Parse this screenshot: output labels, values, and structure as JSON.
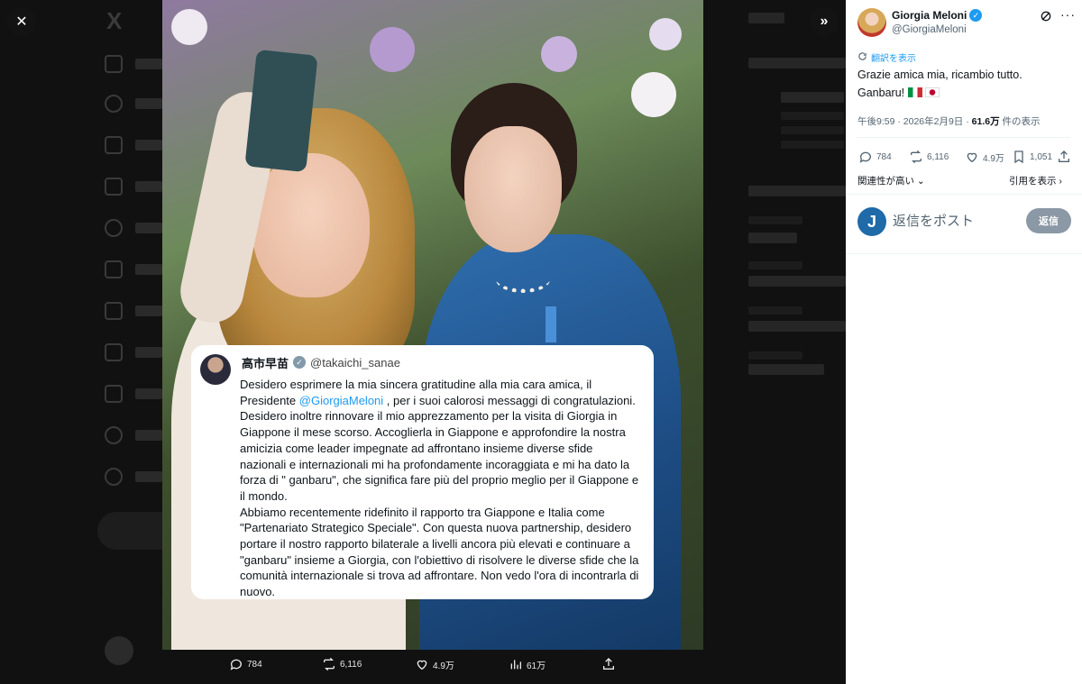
{
  "photo_post": {
    "quote": {
      "author_name": "高市早苗",
      "author_handle": "@takaichi_sanae",
      "text_before_mention": "Desidero esprimere la mia sincera gratitudine alla mia cara amica, il Presidente ",
      "mention": "@GiorgiaMeloni",
      "text_after_mention": " , per i suoi calorosi messaggi di congratulazioni. Desidero inoltre rinnovare il mio apprezzamento per la visita di Giorgia in Giappone il mese scorso. Accoglierla  in Giappone e approfondire la nostra amicizia come leader impegnate ad affrontano insieme diverse sfide nazionali e internazionali mi ha profondamente incoraggiata e mi ha dato la forza di \" ganbaru\", che significa fare più del proprio meglio per il Giappone e il mondo.\nAbbiamo recentemente ridefinito il rapporto tra Giappone e Italia come \"Partenariato Strategico Speciale\". Con questa nuova partnership, desidero portare il nostro rapporto bilaterale a livelli ancora più elevati e continuare a \"ganbaru\" insieme a Giorgia, con l'obiettivo di risolvere le diverse sfide che la comunità internazionale si trova ad affrontare. Non vedo l'ora di incontrarla di nuovo."
    },
    "media_actions": {
      "replies": "784",
      "reposts": "6,116",
      "likes": "4.9万",
      "views": "61万"
    }
  },
  "side_panel": {
    "author_name": "Giorgia Meloni",
    "author_handle": "@GiorgiaMeloni",
    "translate_label": "翻訳を表示",
    "post_text": "Grazie amica mia, ricambio tutto.\nGanbaru!",
    "meta_time": "午後9:59 · 2026年2月9日 · ",
    "meta_views": "61.6万",
    "meta_views_suffix": " 件の表示",
    "actions": {
      "replies": "784",
      "reposts": "6,116",
      "likes": "4.9万",
      "bookmarks": "1,051"
    },
    "sort_label": "関連性が高い",
    "quotes_label": "引用を表示",
    "reply_placeholder": "返信をポスト",
    "reply_button": "返信",
    "reply_avatar_letter": "J"
  },
  "colors": {
    "accent": "#1d9bf0",
    "reply_button": "#8b98a5",
    "overlay_bg": "#0b0b0b"
  }
}
